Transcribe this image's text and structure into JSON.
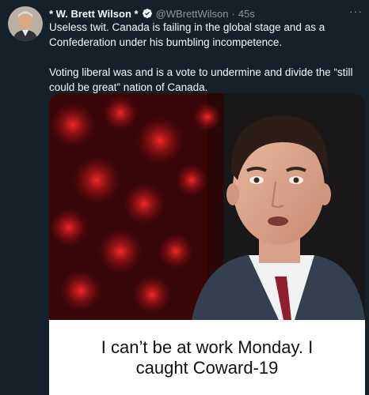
{
  "tweet": {
    "display_name": "* W. Brett Wilson *",
    "handle": "@WBrettWilson",
    "separator": "·",
    "time": "45s",
    "more_icon": "more-horizontal-icon",
    "verified_icon": "verified-badge-icon",
    "paragraphs": [
      "Useless twit. Canada is failing in the global stage and as a Confederation under his bumbling incompetence.",
      "Voting liberal was and is a vote to undermine and divide the “still could be great” nation of Canada."
    ]
  },
  "media": {
    "caption": "I can’t be at work Monday. I caught Coward-19"
  },
  "colors": {
    "background": "#15202b",
    "text": "#f7f9f9",
    "muted": "#8b98a5",
    "verified": "#1d9bf0"
  }
}
